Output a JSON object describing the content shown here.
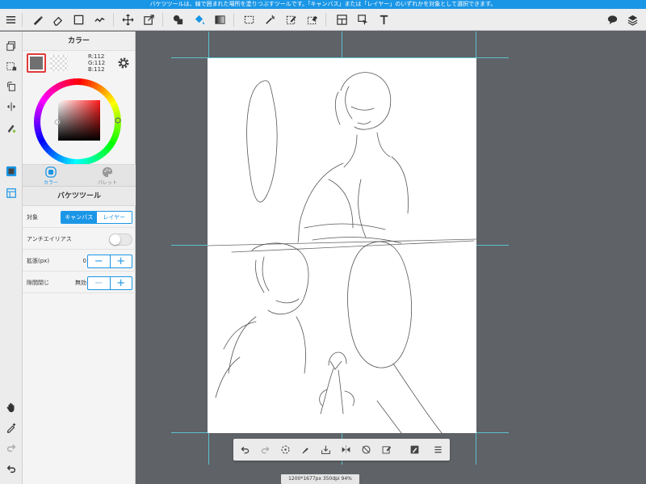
{
  "hint_text": "バケツツールは、線で囲まれた場所を塗りつぶすツールです。「キャンバス」または「レイヤー」のいずれかを対象として選択できます。",
  "color_panel": {
    "title": "カラー",
    "rgb": {
      "r": "R:112",
      "g": "G:112",
      "b": "B:112"
    },
    "main_color": "#707070",
    "tabs": [
      {
        "label": "カラー"
      },
      {
        "label": "パレット"
      }
    ]
  },
  "tool_panel": {
    "title": "バケツツール",
    "target": {
      "label": "対象",
      "options": [
        "キャンバス",
        "レイヤー"
      ],
      "selected": "キャンバス"
    },
    "antialias": {
      "label": "アンチエイリアス",
      "enabled": false
    },
    "expand": {
      "label": "拡張(px)",
      "value": "0",
      "minus": "−",
      "plus": "+"
    },
    "gap_close": {
      "label": "隙間閉じ",
      "value": "無効",
      "minus": "−",
      "plus": "+"
    }
  },
  "accent_color": "#1a96e6",
  "status_text": "1200*1677px 350dpi 94%"
}
